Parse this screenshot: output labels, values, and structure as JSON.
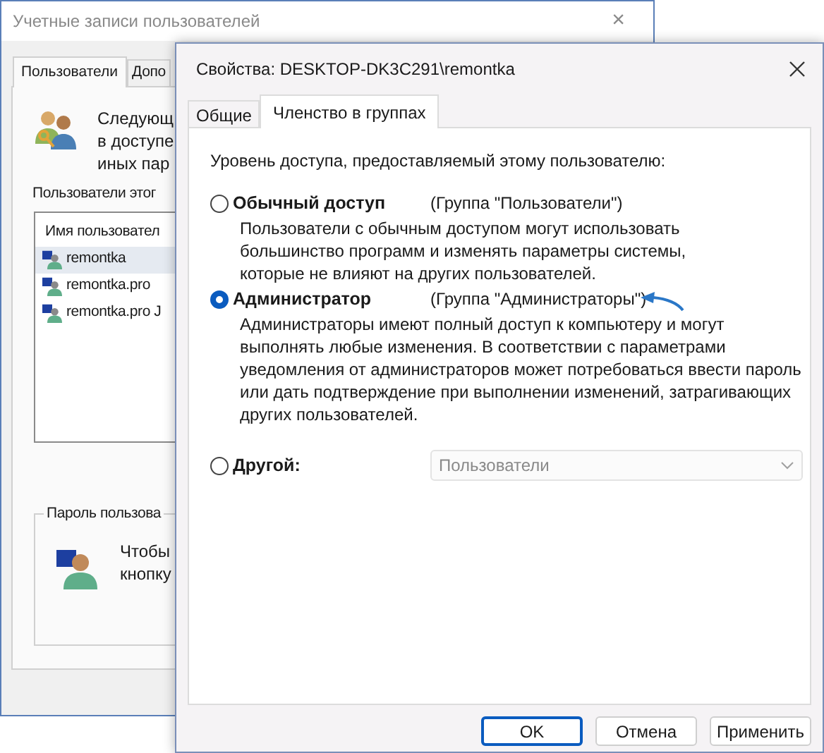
{
  "back_window": {
    "title": "Учетные записи пользователей",
    "close": "×",
    "tabs": [
      {
        "label": "Пользователи",
        "selected": true
      },
      {
        "label": "Допо",
        "selected": false
      }
    ],
    "intro": "Следующ\nв доступе\nиных пар",
    "users_label": "Пользователи этог",
    "users_list": {
      "column": "Имя пользовател",
      "rows": [
        {
          "name": "remontka",
          "selected": true
        },
        {
          "name": "remontka.pro",
          "selected": false
        },
        {
          "name": "remontka.pro J",
          "selected": false
        }
      ]
    },
    "password_group": {
      "title": "Пароль пользова",
      "text": "Чтобы\nкнопку"
    }
  },
  "dialog": {
    "title": "Свойства: DESKTOP-DK3C291\\remontka",
    "tabs": [
      {
        "label": "Общие",
        "selected": false
      },
      {
        "label": "Членство в группах",
        "selected": true
      }
    ],
    "prompt": "Уровень доступа, предоставляемый этому пользователю:",
    "options": [
      {
        "kind": "description",
        "label": "Обычный доступ",
        "group": "(Группа \"Пользователи\")",
        "selected": false,
        "description": "Пользователи с обычным доступом могут использовать\nбольшинство программ и изменять параметры системы,\nкоторые не влияют на других пользователей."
      },
      {
        "kind": "description",
        "label": "Администратор",
        "group": "(Группа \"Администраторы\")",
        "selected": true,
        "description": "Администраторы имеют полный доступ к компьютеру и могут\nвыполнять любые изменения. В соответствии с параметрами\nуведомления от администраторов может потребоваться ввести пароль\nили дать подтверждение при выполнении изменений, затрагивающих\nдругих пользователей."
      },
      {
        "kind": "combo",
        "label": "Другой:",
        "selected": false,
        "value": "Пользователи",
        "disabled": true
      }
    ],
    "buttons": [
      {
        "label": "OK",
        "default": true
      },
      {
        "label": "Отмена",
        "default": false
      },
      {
        "label": "Применить",
        "default": false
      }
    ]
  }
}
